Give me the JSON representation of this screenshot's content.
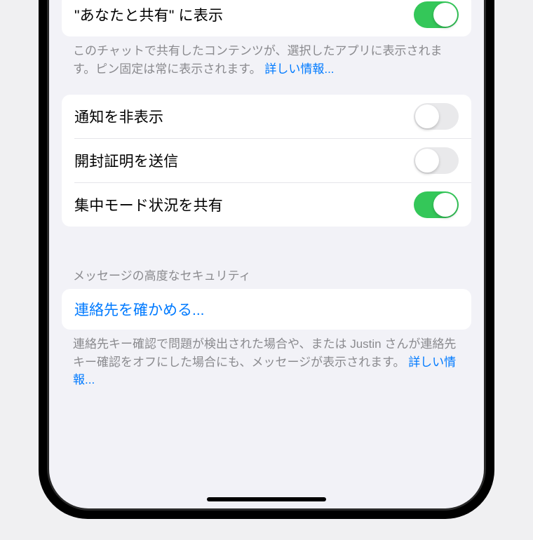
{
  "section1": {
    "row1": {
      "label": "\"あなたと共有\" に表示",
      "toggle": true
    },
    "footer": "このチャットで共有したコンテンツが、選択したアプリに表示されます。ピン固定は常に表示されます。",
    "footerLink": "詳しい情報..."
  },
  "section2": {
    "row1": {
      "label": "通知を非表示",
      "toggle": false
    },
    "row2": {
      "label": "開封証明を送信",
      "toggle": false
    },
    "row3": {
      "label": "集中モード状況を共有",
      "toggle": true
    }
  },
  "section3": {
    "header": "メッセージの高度なセキュリティ",
    "row1": {
      "label": "連絡先を確かめる..."
    },
    "footer": "連絡先キー確認で問題が検出された場合や、または Justin さんが連絡先キー確認をオフにした場合にも、メッセージが表示されます。",
    "footerLink": "詳しい情報..."
  }
}
